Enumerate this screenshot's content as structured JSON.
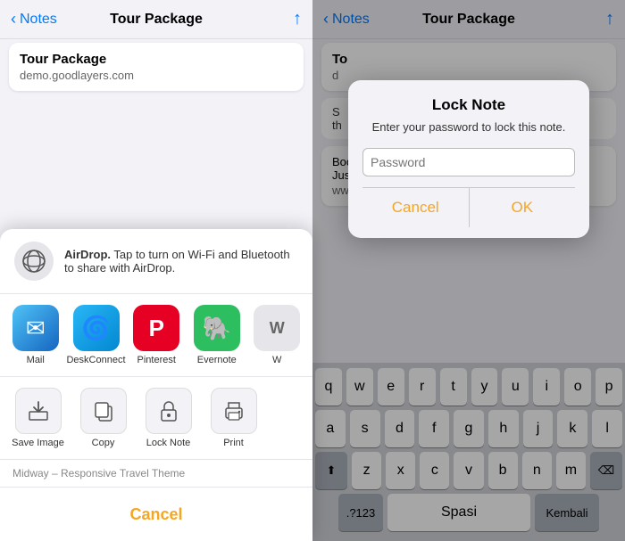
{
  "left": {
    "back_label": "Notes",
    "page_title": "Tour Package",
    "share_icon": "↑",
    "note_card": {
      "title": "Tour Package",
      "subtitle": "demo.goodlayers.com"
    },
    "airdrop": {
      "text_bold": "AirDrop.",
      "text": " Tap to turn on Wi-Fi and Bluetooth to share with AirDrop."
    },
    "app_icons": [
      {
        "label": "Mail",
        "icon": "✉",
        "style": "mail"
      },
      {
        "label": "DeskConnect",
        "icon": "🌀",
        "style": "deskconnect"
      },
      {
        "label": "Pinterest",
        "icon": "P",
        "style": "pinterest"
      },
      {
        "label": "Evernote",
        "icon": "E",
        "style": "evernote"
      },
      {
        "label": "W",
        "icon": "W",
        "style": "more"
      }
    ],
    "action_icons": [
      {
        "label": "Save Image",
        "icon": "⬇"
      },
      {
        "label": "Copy",
        "icon": "📋"
      },
      {
        "label": "Lock Note",
        "icon": "🔒"
      },
      {
        "label": "Print",
        "icon": "🖨"
      }
    ],
    "footer_note": "Midway – Responsive Travel Theme",
    "cancel_label": "Cancel"
  },
  "right": {
    "back_label": "Notes",
    "page_title": "Tour Package",
    "share_icon": "↑",
    "note_card": {
      "line1": "To",
      "line2": "d"
    },
    "note_snippet": "S\nth",
    "additional_note": {
      "title": "Book Your Travel – Premium WordPress Theme » Just another...",
      "url": "www.themeenergy.com"
    },
    "dialog": {
      "title": "Lock Note",
      "message": "Enter your password to lock this note.",
      "input_placeholder": "Password",
      "cancel_label": "Cancel",
      "ok_label": "OK"
    },
    "keyboard": {
      "rows": [
        [
          "q",
          "w",
          "e",
          "r",
          "t",
          "y",
          "u",
          "i",
          "o",
          "p"
        ],
        [
          "a",
          "s",
          "d",
          "f",
          "g",
          "h",
          "j",
          "k",
          "l"
        ],
        [
          "z",
          "x",
          "c",
          "v",
          "b",
          "n",
          "m"
        ],
        [
          ".?123",
          "Spasi",
          "Kembali"
        ]
      ],
      "shift_icon": "⬆",
      "delete_icon": "⌫"
    }
  }
}
